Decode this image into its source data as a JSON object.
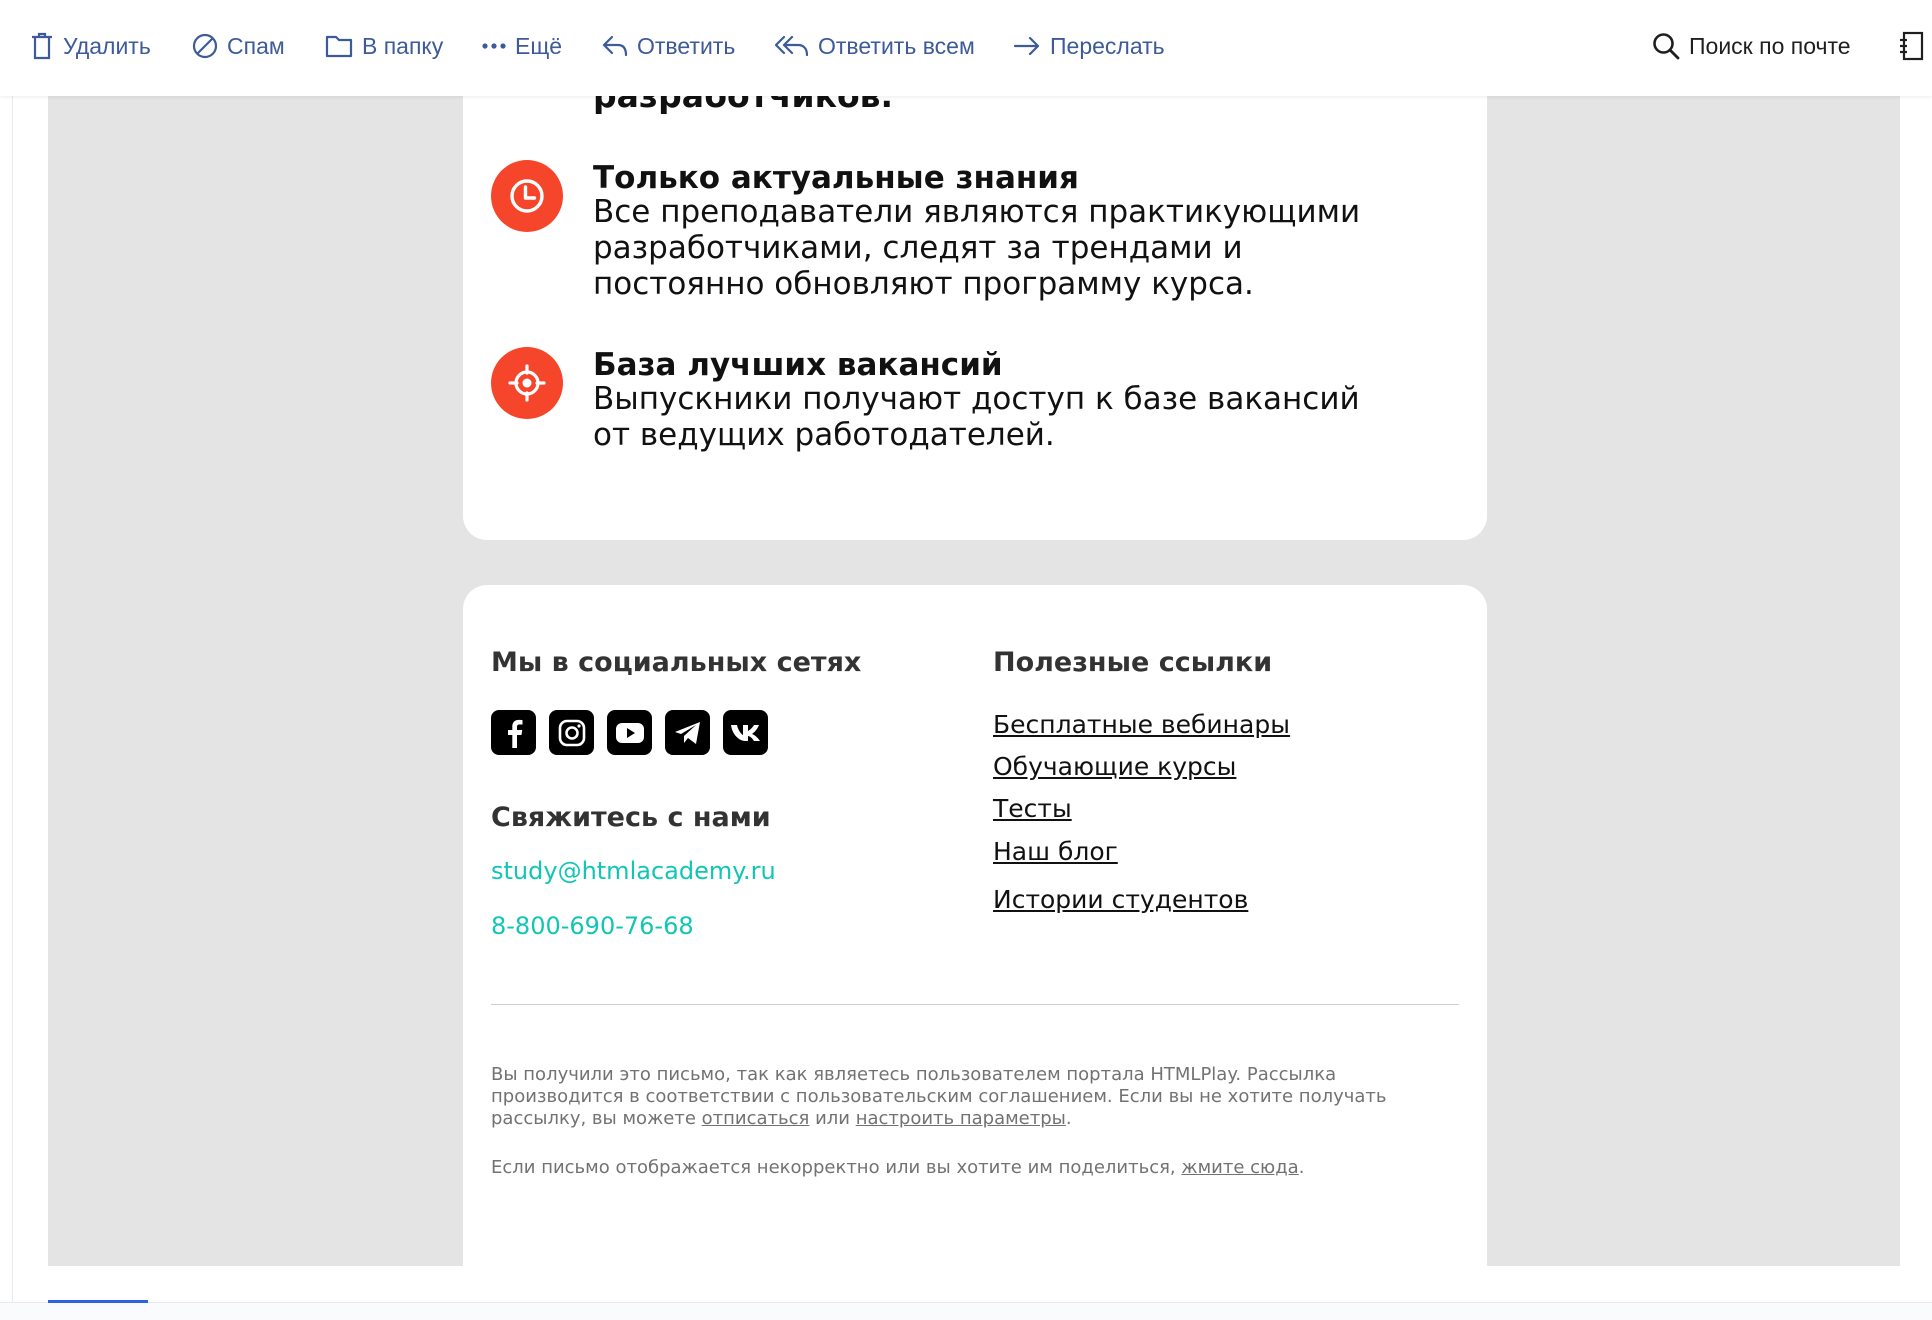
{
  "toolbar": {
    "delete": "Удалить",
    "spam": "Спам",
    "to_folder": "В папку",
    "more": "Ещё",
    "reply": "Ответить",
    "reply_all": "Ответить всем",
    "forward": "Переслать",
    "search": "Поиск по почте"
  },
  "features": {
    "cut_text": "разработчиков.",
    "items": [
      {
        "icon": "clock-icon",
        "title": "Только актуальные знания",
        "text": "Все преподаватели являются практикующими разработчиками, следят за трендами и постоянно обновляют программу курса."
      },
      {
        "icon": "target-icon",
        "title": "База лучших вакансий",
        "text_line1": "Выпускники получают доступ к базе вакансий",
        "text_line2": "от ведущих работодателей."
      }
    ]
  },
  "footer": {
    "social_title": "Мы в социальных сетях",
    "socials": [
      "facebook-icon",
      "instagram-icon",
      "youtube-icon",
      "telegram-icon",
      "vk-icon"
    ],
    "contact_title": "Свяжитесь с нами",
    "email": "study@htmlacademy.ru",
    "phone": "8-800-690-76-68",
    "links_title": "Полезные ссылки",
    "links": [
      "Бесплатные вебинары",
      "Обучающие курсы",
      "Тесты",
      "Наш блог",
      "Истории студентов"
    ],
    "legal1_a": "Вы получили это письмо, так как являетесь пользователем портала HTMLPlay. Рассылка производится в соответствии с пользовательским соглашением. Если вы не хотите получать рассылку, вы можете ",
    "legal1_link1": "отписаться",
    "legal1_mid": " или ",
    "legal1_link2": "настроить параметры",
    "legal1_end": ".",
    "legal2_a": "Если письмо отображается некорректно или вы хотите им поделиться, ",
    "legal2_link": "жмите сюда",
    "legal2_end": "."
  },
  "colors": {
    "accent_red": "#f5462c",
    "link_teal": "#12c6b4",
    "toolbar_blue": "#3d5a99"
  }
}
